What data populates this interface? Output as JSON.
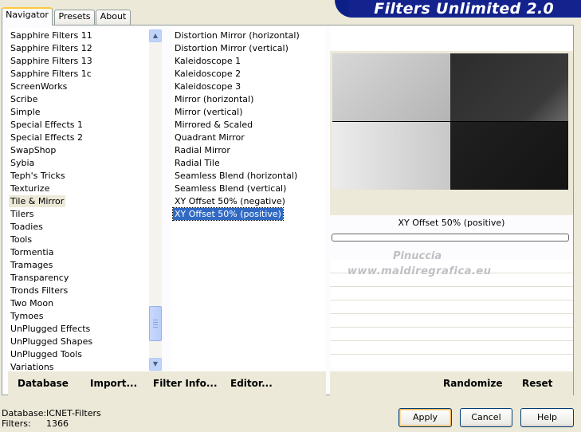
{
  "app": {
    "banner_title": "Filters Unlimited 2.0"
  },
  "tabs": [
    {
      "label": "Navigator",
      "active": true
    },
    {
      "label": "Presets",
      "active": false
    },
    {
      "label": "About",
      "active": false
    }
  ],
  "categories": [
    {
      "label": "Sapphire Filters 11"
    },
    {
      "label": "Sapphire Filters 12"
    },
    {
      "label": "Sapphire Filters 13"
    },
    {
      "label": "Sapphire Filters 1c"
    },
    {
      "label": "ScreenWorks"
    },
    {
      "label": "Scribe"
    },
    {
      "label": "Simple"
    },
    {
      "label": "Special Effects 1"
    },
    {
      "label": "Special Effects 2"
    },
    {
      "label": "SwapShop"
    },
    {
      "label": "Sybia"
    },
    {
      "label": "Teph's Tricks"
    },
    {
      "label": "Texturize"
    },
    {
      "label": "Tile & Mirror",
      "selected": true
    },
    {
      "label": "Tilers"
    },
    {
      "label": "Toadies"
    },
    {
      "label": "Tools"
    },
    {
      "label": "Tormentia"
    },
    {
      "label": "Tramages"
    },
    {
      "label": "Transparency"
    },
    {
      "label": "Tronds Filters"
    },
    {
      "label": "Two Moon"
    },
    {
      "label": "Tymoes"
    },
    {
      "label": "UnPlugged Effects"
    },
    {
      "label": "UnPlugged Shapes"
    },
    {
      "label": "UnPlugged Tools"
    },
    {
      "label": "Variations"
    }
  ],
  "filters": [
    {
      "label": "Distortion Mirror (horizontal)"
    },
    {
      "label": "Distortion Mirror (vertical)"
    },
    {
      "label": "Kaleidoscope 1"
    },
    {
      "label": "Kaleidoscope 2"
    },
    {
      "label": "Kaleidoscope 3"
    },
    {
      "label": "Mirror (horizontal)"
    },
    {
      "label": "Mirror (vertical)"
    },
    {
      "label": "Mirrored & Scaled"
    },
    {
      "label": "Quadrant Mirror"
    },
    {
      "label": "Radial Mirror"
    },
    {
      "label": "Radial Tile"
    },
    {
      "label": "Seamless Blend (horizontal)"
    },
    {
      "label": "Seamless Blend (vertical)"
    },
    {
      "label": "XY Offset 50% (negative)"
    },
    {
      "label": "XY Offset 50% (positive)",
      "selected": true
    }
  ],
  "scrollbar": {
    "up_icon": "▲",
    "down_icon": "▼"
  },
  "preview": {
    "filter_name": "XY Offset 50% (positive)",
    "watermark_line1": "Pinuccia",
    "watermark_line2": "www.maldiregrafica.eu"
  },
  "links": {
    "database": "Database",
    "import": "Import...",
    "filter_info": "Filter Info...",
    "editor": "Editor...",
    "randomize": "Randomize",
    "reset": "Reset"
  },
  "status": {
    "database_label": "Database:",
    "database_value": "ICNET-Filters",
    "filters_label": "Filters:",
    "filters_value": "1366"
  },
  "buttons": {
    "apply": "Apply",
    "cancel": "Cancel",
    "help": "Help"
  },
  "colors": {
    "banner": "#0c1f87",
    "selection": "#316ac5",
    "dialog_bg": "#ece9d8"
  }
}
